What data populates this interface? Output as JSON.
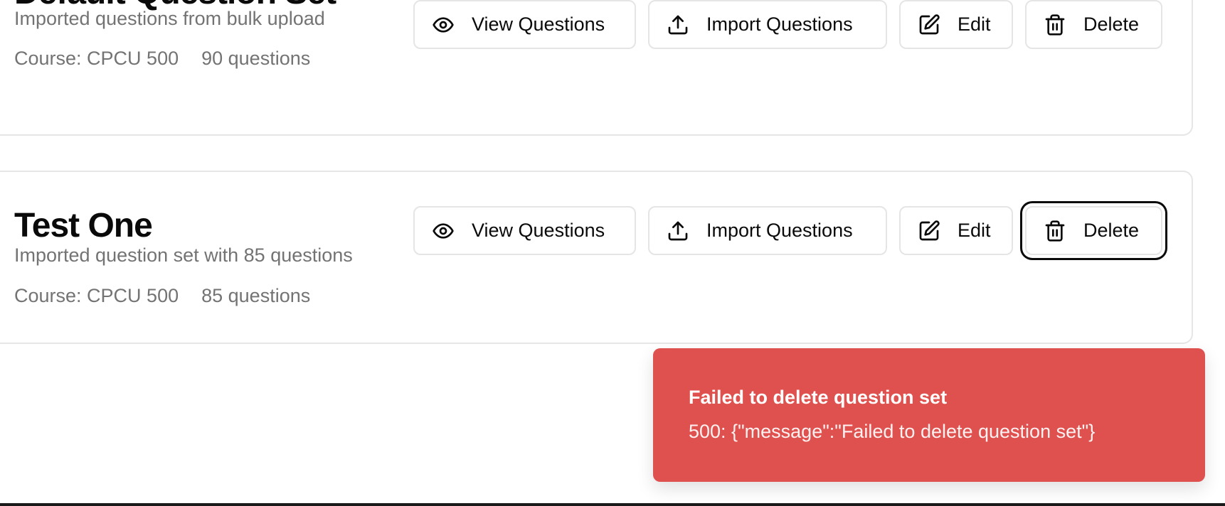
{
  "question_sets": [
    {
      "title": "Default Question Set",
      "description": "Imported questions from bulk upload",
      "course": "Course: CPCU 500",
      "count": "90 questions"
    },
    {
      "title": "Test One",
      "description": "Imported question set with 85 questions",
      "course": "Course: CPCU 500",
      "count": "85 questions"
    }
  ],
  "actions": {
    "view": "View Questions",
    "import": "Import Questions",
    "edit": "Edit",
    "delete": "Delete"
  },
  "icons": {
    "view": "eye-icon",
    "import": "upload-icon",
    "edit": "edit-icon",
    "delete": "trash-icon"
  },
  "toast": {
    "title": "Failed to delete question set",
    "message": "500: {\"message\":\"Failed to delete question set\"}",
    "color": "#df514e"
  }
}
